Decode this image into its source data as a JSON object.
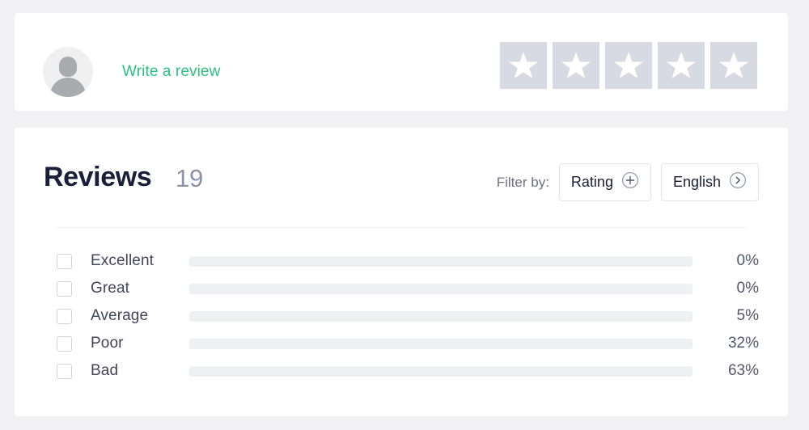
{
  "review_prompt": {
    "avatar": "user-avatar",
    "link_label": "Write a review",
    "link_color": "#2bc27f",
    "star_count": 5,
    "star_tile_color": "#d7d9e3"
  },
  "reviews_panel": {
    "title": "Reviews",
    "count": "19",
    "filter_label": "Filter by:",
    "filters": [
      {
        "label": "Rating",
        "icon": "plus-circle-icon"
      },
      {
        "label": "English",
        "icon": "chevron-right-circle-icon"
      }
    ]
  },
  "chart_data": {
    "type": "bar",
    "title": "Reviews",
    "orientation": "horizontal",
    "xlabel": "",
    "ylabel": "",
    "xlim": [
      0,
      100
    ],
    "grid": false,
    "legend": "none",
    "categories": [
      "Excellent",
      "Great",
      "Average",
      "Poor",
      "Bad"
    ],
    "values": [
      0,
      0,
      5,
      32,
      63
    ],
    "value_labels": [
      "0%",
      "0%",
      "5%",
      "32%",
      "63%"
    ],
    "bar_color": "#6e7088",
    "track_color": "#eff0f2"
  }
}
